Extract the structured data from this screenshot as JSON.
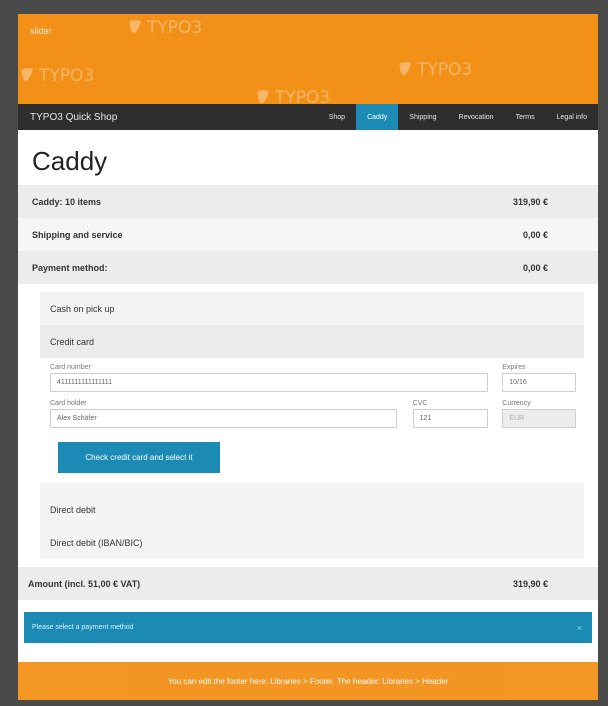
{
  "slider": {
    "label": "slider",
    "watermark": "TYPO3"
  },
  "nav": {
    "brand": "TYPO3 Quick Shop",
    "items": [
      "Shop",
      "Caddy",
      "Shipping",
      "Revocation",
      "Terms",
      "Legal info"
    ],
    "active_index": 1
  },
  "page": {
    "title": "Caddy"
  },
  "summary": {
    "caddy_label": "Caddy: 10 items",
    "caddy_value": "319,90 €",
    "shipping_label": "Shipping and service",
    "shipping_value": "0,00 €",
    "payment_label": "Payment method:",
    "payment_value": "0,00 €"
  },
  "payment_options": {
    "cash": "Cash on pick up",
    "credit": "Credit card",
    "direct_debit": "Direct debit",
    "direct_debit_iban": "Direct debit (IBAN/BIC)"
  },
  "credit_form": {
    "card_number_label": "Card number",
    "card_number_value": "4111111111111111",
    "expires_label": "Expires",
    "expires_value": "10/16",
    "card_holder_label": "Card holder",
    "card_holder_value": "Alex Schäfer",
    "cvc_label": "CVC",
    "cvc_value": "121",
    "currency_label": "Currency",
    "currency_value": "EUR",
    "submit_label": "Check credit card and select it"
  },
  "total": {
    "label": "Amount (incl. 51,00 € VAT)",
    "value": "319,90 €"
  },
  "alert": {
    "text": "Please select a payment method",
    "close": "×"
  },
  "footer": {
    "text": "You can edit the footer here: Libraries > Footer. The header: Libraries > Header"
  },
  "colors": {
    "accent": "#1b8bb6",
    "brand": "#f39017",
    "nav_bg": "#2e2e2e"
  }
}
